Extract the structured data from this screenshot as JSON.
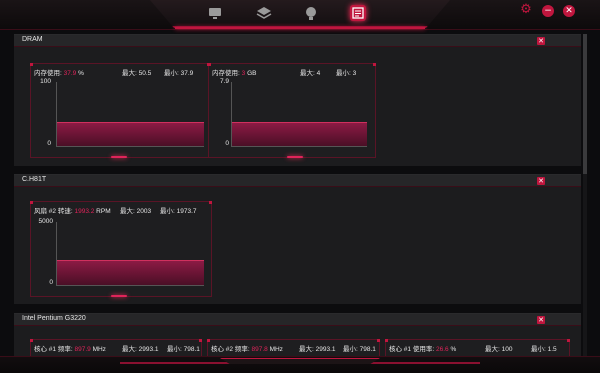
{
  "topbar": {
    "nav": [
      {
        "name": "monitor"
      },
      {
        "name": "layers"
      },
      {
        "name": "bulb"
      },
      {
        "name": "sensor-panel",
        "active": true
      }
    ],
    "controls": {
      "settings": "⚙",
      "minimize": "−",
      "close": "✕"
    }
  },
  "accent_color": "#c0163e",
  "sections": [
    {
      "title": "DRAM",
      "close_label": "✕",
      "widgets": [
        {
          "label": "内存使用:",
          "value": "37.9",
          "unit": "%",
          "max_label": "最大:",
          "max": "50.5",
          "min_label": "最小:",
          "min": "37.9",
          "y_top": "100",
          "y_bottom": "0",
          "level": 0.379
        },
        {
          "label": "内存使用:",
          "value": "3",
          "unit": "GB",
          "max_label": "最大:",
          "max": "4",
          "min_label": "最小:",
          "min": "3",
          "y_top": "7.9",
          "y_bottom": "0",
          "level": 0.38
        }
      ]
    },
    {
      "title": "C.H81T",
      "close_label": "✕",
      "widgets": [
        {
          "label": "风扇 #2 转速:",
          "value": "1993.2",
          "unit": "RPM",
          "max_label": "最大:",
          "max": "2003",
          "min_label": "最小:",
          "min": "1973.7",
          "y_top": "5000",
          "y_bottom": "0",
          "level": 0.399
        }
      ]
    },
    {
      "title": "Intel Pentium G3220",
      "close_label": "✕",
      "widgets": [
        {
          "label": "核心 #1 频率:",
          "value": "897.9",
          "unit": "MHz",
          "max_label": "最大:",
          "max": "2993.1",
          "min_label": "最小:",
          "min": "798.1"
        },
        {
          "label": "核心 #2 频率:",
          "value": "897.8",
          "unit": "MHz",
          "max_label": "最大:",
          "max": "2993.1",
          "min_label": "最小:",
          "min": "798.1"
        },
        {
          "label": "核心 #1 使用率:",
          "value": "26.6",
          "unit": "%",
          "max_label": "最大:",
          "max": "100",
          "min_label": "最小:",
          "min": "1.5"
        }
      ]
    }
  ]
}
